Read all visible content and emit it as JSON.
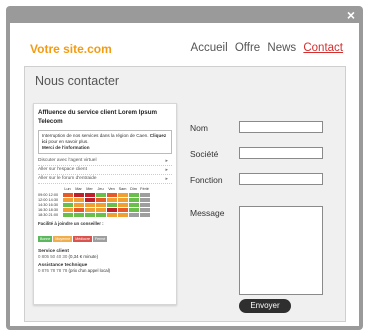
{
  "window": {
    "close_glyph": "×"
  },
  "header": {
    "site_name": "Votre site.com",
    "nav": [
      "Accueil",
      "Offre",
      "News",
      "Contact"
    ],
    "active": "Contact"
  },
  "panel": {
    "title": "Nous contacter"
  },
  "card": {
    "title": "Affluence du service client Lorem Ipsum Telecom",
    "info_line1": "Interruption de nos services dans la région de Caen.",
    "info_link": "Cliquez ici",
    "info_line2": "pour en savoir plus.",
    "info_thanks": "Merci de l'information",
    "links": [
      "Discuter avec l'agent virtuel",
      "Aller sur l'espace client",
      "Aller sur le forum d'entraide"
    ],
    "days": [
      "Lun",
      "Mar",
      "Mer",
      "Jeu",
      "Ven",
      "Sam",
      "Dim",
      "Férié"
    ],
    "times": [
      "09:00 12:00",
      "12:00 14:30",
      "14:30 16:30",
      "16:30 18:30",
      "18:30 21:00"
    ],
    "grid": [
      [
        "r",
        "dr",
        "dr",
        "g",
        "r",
        "o",
        "g",
        "gr"
      ],
      [
        "o",
        "o",
        "dr",
        "r",
        "o",
        "o",
        "g",
        "gr"
      ],
      [
        "g",
        "o",
        "o",
        "o",
        "g",
        "o",
        "g",
        "gr"
      ],
      [
        "o",
        "r",
        "o",
        "o",
        "dr",
        "r",
        "g",
        "gr"
      ],
      [
        "g",
        "g",
        "g",
        "g",
        "o",
        "o",
        "gr",
        "gr"
      ]
    ],
    "legend_title": "Facilité à joindre un conseiller :",
    "legend": [
      {
        "label": "Bonne",
        "color": "#5cb85c"
      },
      {
        "label": "Moyenne",
        "color": "#f0ad4e"
      },
      {
        "label": "Médiocre",
        "color": "#d9534f"
      },
      {
        "label": "Fermé",
        "color": "#9e9e9e"
      }
    ],
    "svc_title": "Service client",
    "svc_phone": "0 805 50 40 30",
    "svc_price": "(0,34 € minute)",
    "tech_title": "Assistance technique",
    "tech_phone": "0 876 78 78 78",
    "tech_price": "(prix d'un appel local)"
  },
  "form": {
    "name_label": "Nom",
    "company_label": "Société",
    "function_label": "Fonction",
    "message_label": "Message",
    "send_label": "Envoyer"
  },
  "colors": {
    "g": "#6abf4b",
    "o": "#f0a030",
    "r": "#e65a2a",
    "dr": "#c0202a",
    "gr": "#9e9e9e"
  }
}
